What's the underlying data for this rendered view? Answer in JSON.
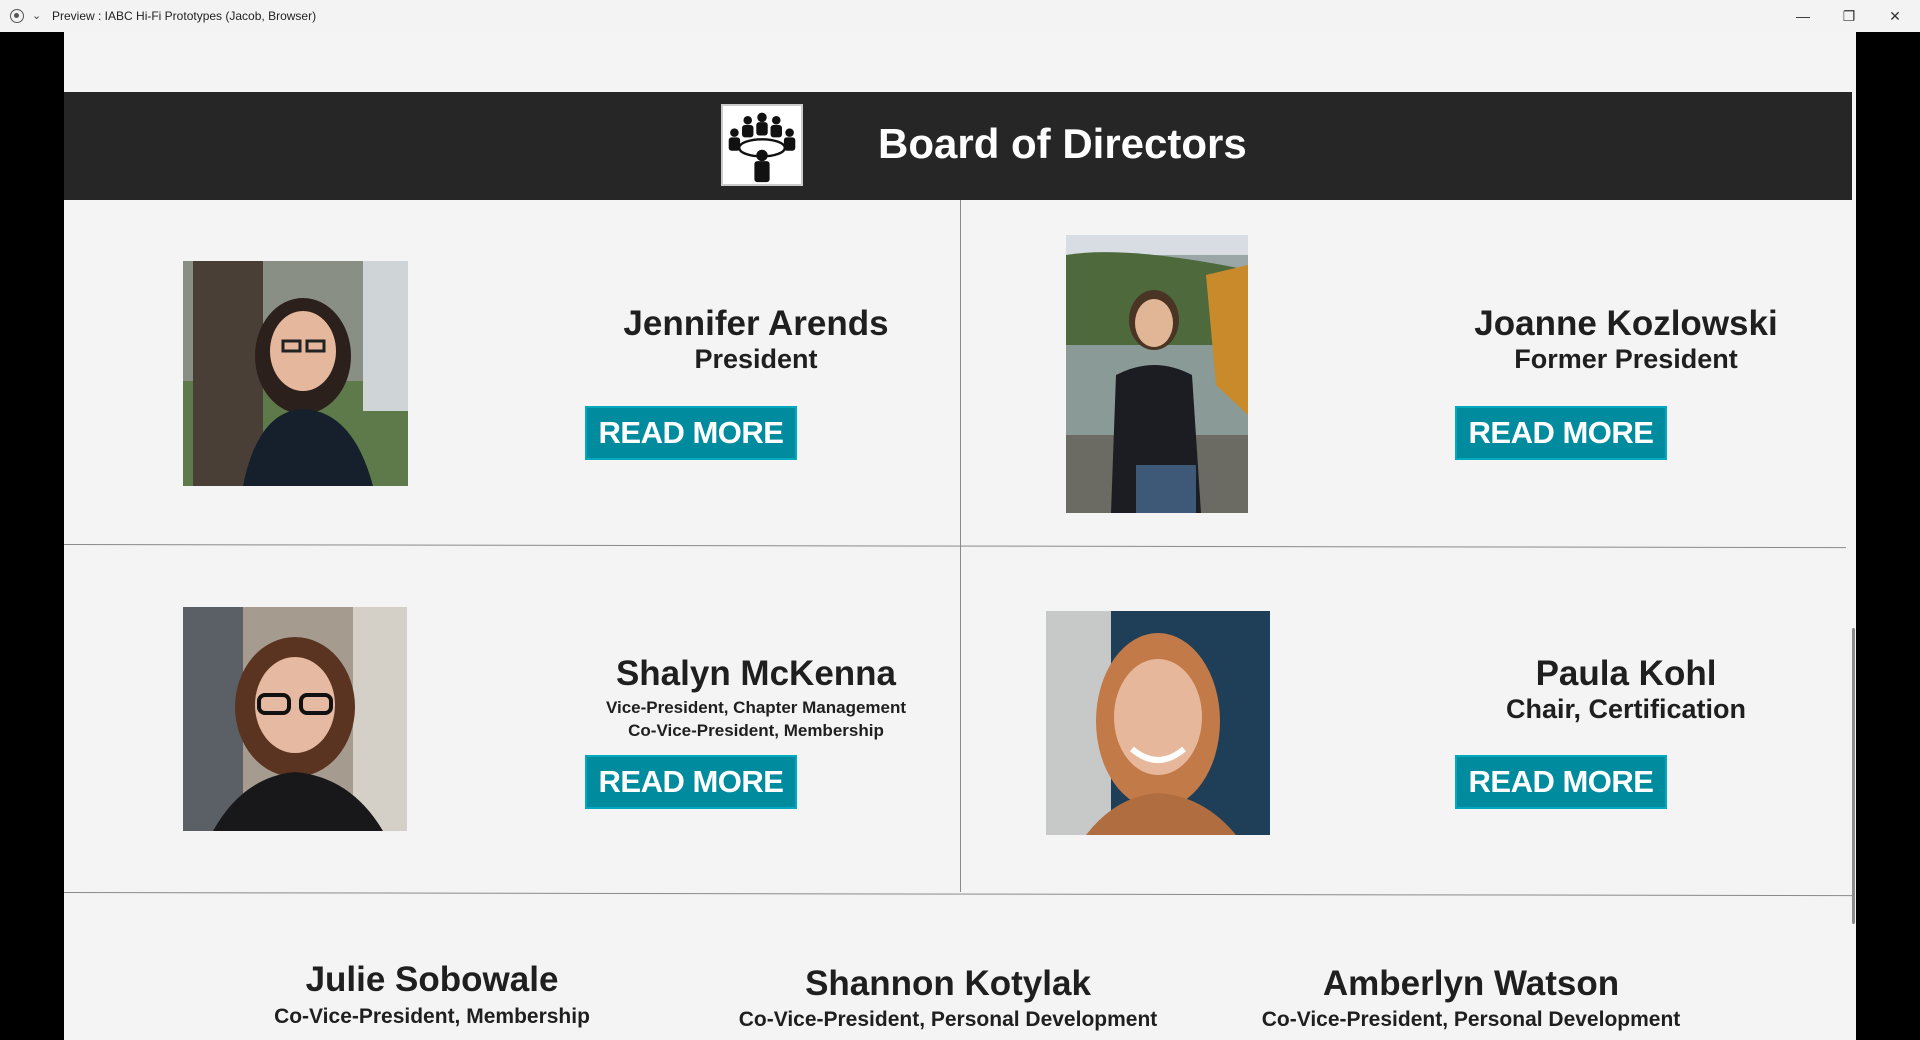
{
  "window": {
    "title": "Preview : IABC Hi-Fi Prototypes (Jacob, Browser)",
    "minimize_glyph": "—",
    "maximize_glyph": "❐",
    "close_glyph": "✕",
    "chevron_glyph": "⌄"
  },
  "banner": {
    "title": "Board of Directors",
    "logo_icon": "board-meeting-icon",
    "background": "#262626"
  },
  "directors": [
    {
      "name": "Jennifer Arends",
      "roles": [
        "President"
      ],
      "button": "READ MORE"
    },
    {
      "name": "Joanne Kozlowski",
      "roles": [
        "Former President"
      ],
      "button": "READ MORE"
    },
    {
      "name": "Shalyn McKenna",
      "roles": [
        "Vice-President, Chapter Management",
        "Co-Vice-President, Membership"
      ],
      "button": "READ MORE"
    },
    {
      "name": "Paula Kohl",
      "roles": [
        "Chair, Certification"
      ],
      "button": "READ MORE"
    }
  ],
  "bottom_directors": [
    {
      "name": "Julie Sobowale",
      "role": "Co-Vice-President, Membership"
    },
    {
      "name": "Shannon Kotylak",
      "role": "Co-Vice-President, Personal Development"
    },
    {
      "name": "Amberlyn Watson",
      "role": "Co-Vice-President, Personal Development"
    }
  ],
  "colors": {
    "accent": "#008b9f",
    "page_bg": "#f4f4f4",
    "text": "#1f1f1f"
  }
}
